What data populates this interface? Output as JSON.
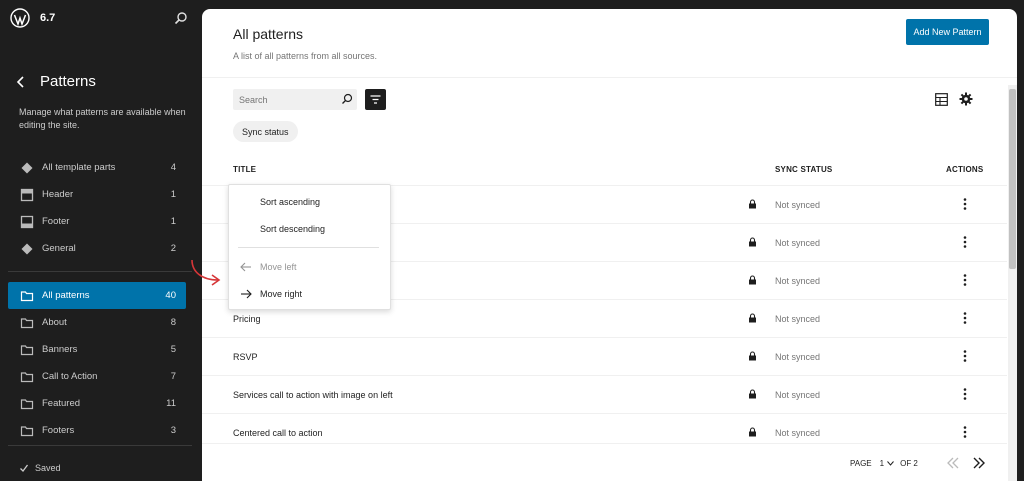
{
  "sidebar": {
    "site_version": "6.7",
    "title": "Patterns",
    "description": "Manage what patterns are available when editing the site.",
    "template_parts": [
      {
        "label": "All template parts",
        "count": "4",
        "icon": "diamond-icon"
      },
      {
        "label": "Header",
        "count": "1",
        "icon": "header-layout-icon"
      },
      {
        "label": "Footer",
        "count": "1",
        "icon": "footer-layout-icon"
      },
      {
        "label": "General",
        "count": "2",
        "icon": "diamond-icon"
      }
    ],
    "categories": [
      {
        "label": "All patterns",
        "count": "40",
        "active": true
      },
      {
        "label": "About",
        "count": "8"
      },
      {
        "label": "Banners",
        "count": "5"
      },
      {
        "label": "Call to Action",
        "count": "7"
      },
      {
        "label": "Featured",
        "count": "11"
      },
      {
        "label": "Footers",
        "count": "3"
      }
    ],
    "saved_label": "Saved"
  },
  "main": {
    "title": "All patterns",
    "subtitle": "A list of all patterns from all sources.",
    "add_button": "Add New Pattern",
    "search_placeholder": "Search",
    "filter_chip": "Sync status",
    "columns": {
      "title": "TITLE",
      "sync": "SYNC STATUS",
      "actions": "ACTIONS"
    },
    "rows": [
      {
        "title": "",
        "status": "Not synced"
      },
      {
        "title": "",
        "status": "Not synced"
      },
      {
        "title": "",
        "status": "Not synced"
      },
      {
        "title": "Pricing",
        "status": "Not synced"
      },
      {
        "title": "RSVP",
        "status": "Not synced"
      },
      {
        "title": "Services call to action with image on left",
        "status": "Not synced"
      },
      {
        "title": "Centered call to action",
        "status": "Not synced"
      }
    ],
    "pagination": {
      "page_label": "PAGE",
      "current_page": "1",
      "of_label": "OF 2"
    }
  },
  "column_menu": {
    "sort_ascending": "Sort ascending",
    "sort_descending": "Sort descending",
    "move_left": "Move left",
    "move_right": "Move right"
  },
  "colors": {
    "accent": "#0073aa",
    "sidebar_bg": "#1e1e1e",
    "annotation_arrow": "#d63638"
  }
}
